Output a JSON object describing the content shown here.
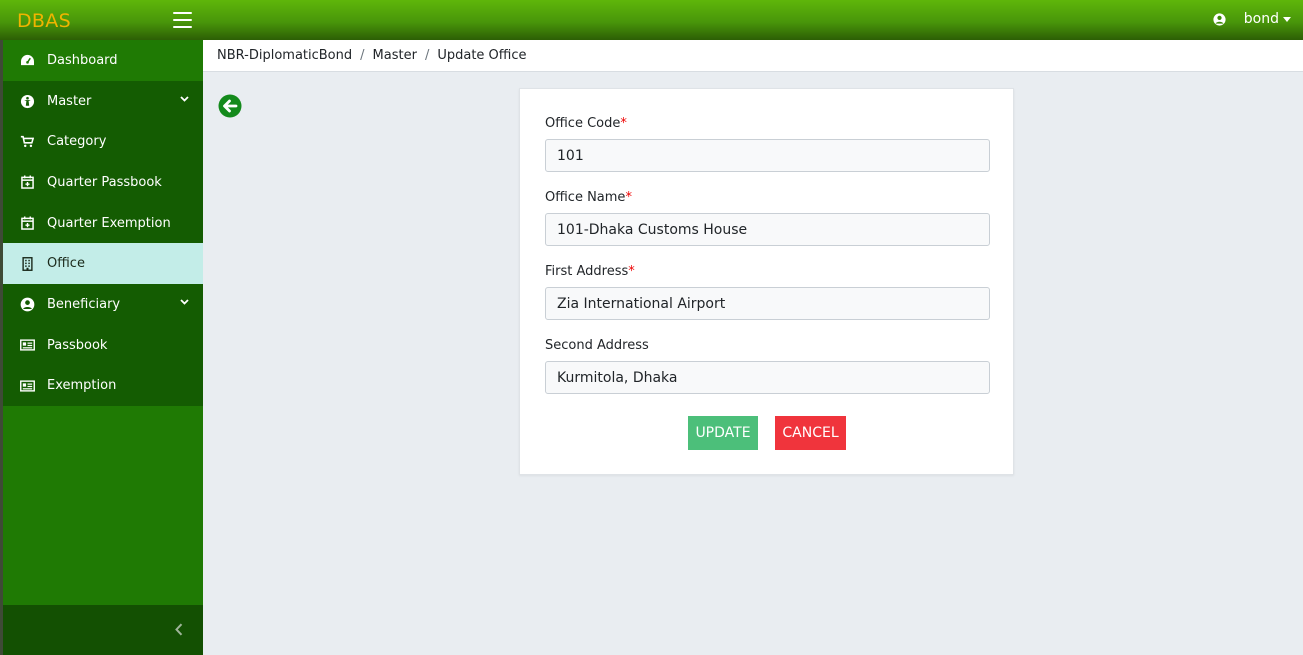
{
  "app": {
    "brand": "DBAS"
  },
  "user": {
    "name": "bond"
  },
  "sidebar": {
    "items": [
      {
        "label": "Dashboard",
        "icon": "dashboard-icon"
      },
      {
        "label": "Master",
        "icon": "master-icon"
      },
      {
        "label": "Category",
        "icon": "cart-icon"
      },
      {
        "label": "Quarter Passbook",
        "icon": "calendar-plus-icon"
      },
      {
        "label": "Quarter Exemption",
        "icon": "calendar-plus-icon"
      },
      {
        "label": "Office",
        "icon": "building-icon"
      },
      {
        "label": "Beneficiary",
        "icon": "user-circle-icon"
      },
      {
        "label": "Passbook",
        "icon": "id-card-icon"
      },
      {
        "label": "Exemption",
        "icon": "id-card-icon"
      }
    ],
    "active": "Office"
  },
  "breadcrumb": {
    "root": "NBR-DiplomaticBond",
    "section": "Master",
    "current": "Update Office"
  },
  "form": {
    "office_code": {
      "label": "Office Code",
      "required": "*",
      "value": "101"
    },
    "office_name": {
      "label": "Office Name",
      "required": "*",
      "value": "101-Dhaka Customs House"
    },
    "first_address": {
      "label": "First Address",
      "required": "*",
      "value": "Zia International Airport"
    },
    "second_address": {
      "label": "Second Address",
      "value": "Kurmitola, Dhaka"
    },
    "update_label": "UPDATE",
    "cancel_label": "CANCEL"
  },
  "colors": {
    "brand": "#f0b400",
    "sidebar": "#1f7a04",
    "active_item": "#c3ede8",
    "update": "#4cbf7a",
    "cancel": "#f0343c",
    "required": "#e00000"
  }
}
